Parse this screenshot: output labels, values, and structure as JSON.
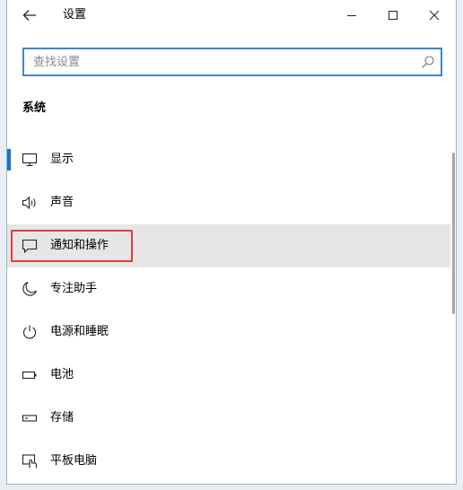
{
  "window": {
    "title": "设置"
  },
  "search": {
    "placeholder": "查找设置"
  },
  "section": {
    "title": "系统"
  },
  "nav": {
    "items": [
      {
        "label": "显示",
        "icon": "monitor-icon",
        "active": true
      },
      {
        "label": "声音",
        "icon": "speaker-icon"
      },
      {
        "label": "通知和操作",
        "icon": "notification-icon",
        "hover": true,
        "highlighted": true
      },
      {
        "label": "专注助手",
        "icon": "moon-icon"
      },
      {
        "label": "电源和睡眠",
        "icon": "power-icon"
      },
      {
        "label": "电池",
        "icon": "battery-icon"
      },
      {
        "label": "存储",
        "icon": "storage-icon"
      },
      {
        "label": "平板电脑",
        "icon": "tablet-icon"
      }
    ]
  },
  "colors": {
    "accent": "#1e6fc7",
    "search_border": "#3f86c6",
    "highlight": "#e03c3c",
    "hover_bg": "#e6e6e6"
  }
}
